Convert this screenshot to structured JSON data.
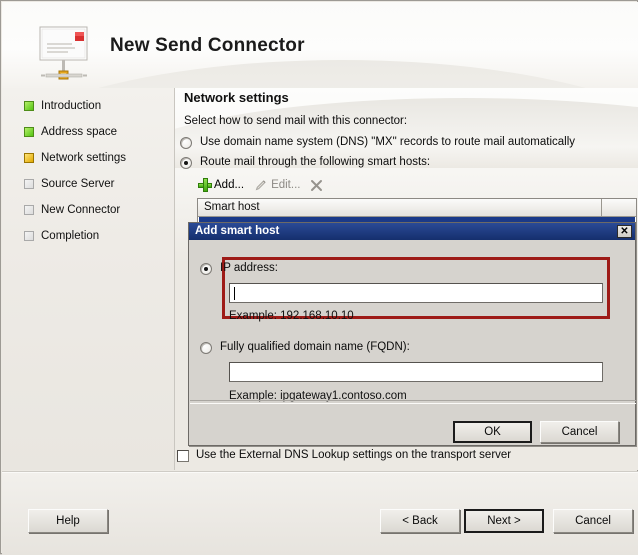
{
  "window": {
    "title": "New Send Connector",
    "icon": "send-connector-envelope-icon"
  },
  "sidebar": {
    "items": [
      {
        "label": "Introduction",
        "state": "done"
      },
      {
        "label": "Address space",
        "state": "done"
      },
      {
        "label": "Network settings",
        "state": "current"
      },
      {
        "label": "Source Server",
        "state": "todo"
      },
      {
        "label": "New Connector",
        "state": "todo"
      },
      {
        "label": "Completion",
        "state": "todo"
      }
    ]
  },
  "main": {
    "page_title": "Network settings",
    "intro": "Select how to send mail with this connector:",
    "options": [
      {
        "label": "Use domain name system (DNS) \"MX\" records to route mail automatically",
        "selected": false
      },
      {
        "label": "Route mail through the following smart hosts:",
        "selected": true
      }
    ],
    "toolbar": {
      "add_label": "Add...",
      "edit_label": "Edit...",
      "remove_label": ""
    },
    "list": {
      "columns": [
        "Smart host",
        ""
      ],
      "rows": [
        ""
      ]
    },
    "external_dns_checkbox": {
      "label": "Use the External DNS Lookup settings on the transport server",
      "checked": false
    }
  },
  "dialog": {
    "title": "Add smart host",
    "close_label": "✕",
    "ip_option": {
      "label": "IP address:",
      "selected": true,
      "value": "",
      "placeholder": "",
      "example": "Example: 192.168.10.10"
    },
    "fqdn_option": {
      "label": "Fully qualified domain name (FQDN):",
      "selected": false,
      "value": "",
      "placeholder": "",
      "example": "Example: ipgateway1.contoso.com"
    },
    "ok_label": "OK",
    "cancel_label": "Cancel",
    "highlight_color": "#9e1b17",
    "titlebar_color": "#1b3a88"
  },
  "footer": {
    "help_label": "Help",
    "back_label": "< Back",
    "next_label": "Next >",
    "cancel_label": "Cancel"
  }
}
